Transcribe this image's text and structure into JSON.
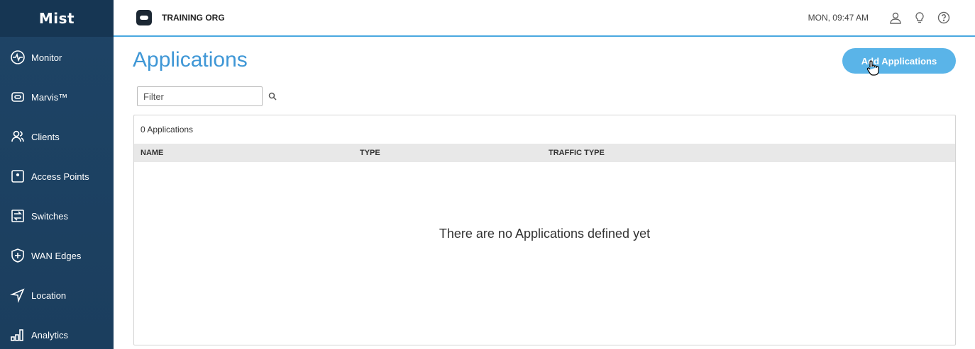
{
  "sidebar": {
    "logo": "Mist",
    "items": [
      {
        "label": "Monitor",
        "icon": "monitor-icon"
      },
      {
        "label": "Marvis™",
        "icon": "marvis-icon"
      },
      {
        "label": "Clients",
        "icon": "clients-icon"
      },
      {
        "label": "Access Points",
        "icon": "access-points-icon"
      },
      {
        "label": "Switches",
        "icon": "switches-icon"
      },
      {
        "label": "WAN Edges",
        "icon": "wan-edges-icon"
      },
      {
        "label": "Location",
        "icon": "location-icon"
      },
      {
        "label": "Analytics",
        "icon": "analytics-icon"
      }
    ]
  },
  "header": {
    "org_name": "TRAINING ORG",
    "clock": "MON, 09:47 AM"
  },
  "main": {
    "title": "Applications",
    "add_button": "Add Applications",
    "filter_placeholder": "Filter",
    "count_label": "0 Applications",
    "columns": [
      "NAME",
      "TYPE",
      "TRAFFIC TYPE"
    ],
    "empty_message": "There are no Applications defined yet"
  },
  "colors": {
    "sidebar": "#1e4466",
    "accent": "#3f97d6",
    "button": "#5ab4e8"
  }
}
